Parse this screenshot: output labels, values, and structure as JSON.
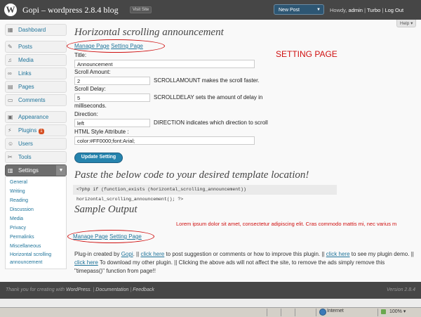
{
  "header": {
    "logo_letter": "W",
    "site_title": "Gopi – wordpress 2.8.4 blog",
    "visit_site": "Visit Site",
    "new_post": "New Post",
    "howdy": "Howdy,",
    "username": "admin",
    "turbo": "Turbo",
    "logout": "Log Out"
  },
  "help": "Help",
  "sidebar": {
    "dashboard": "Dashboard",
    "posts": "Posts",
    "media": "Media",
    "links": "Links",
    "pages": "Pages",
    "comments": "Comments",
    "appearance": "Appearance",
    "plugins": "Plugins",
    "plugins_badge": "1",
    "users": "Users",
    "tools": "Tools",
    "settings": "Settings",
    "settings_sub": [
      "General",
      "Writing",
      "Reading",
      "Discussion",
      "Media",
      "Privacy",
      "Permalinks",
      "Miscellaneous",
      "Horizontal scrolling announcement"
    ]
  },
  "main": {
    "title": "Horizontal scrolling announcement",
    "manage_page": "Manage Page",
    "setting_page_link": "Setting Page",
    "setting_page_label": "SETTING PAGE",
    "form": {
      "title_label": "Title:",
      "title_value": "Announcement",
      "scroll_amount_label": "Scroll Amount:",
      "scroll_amount_value": "2",
      "scroll_amount_desc": "SCROLLAMOUNT makes the scroll faster.",
      "scroll_delay_label": "Scroll Delay:",
      "scroll_delay_value": "5",
      "scroll_delay_desc_1": "SCROLLDELAY sets the amount of delay in",
      "scroll_delay_desc_2": "milliseconds.",
      "direction_label": "Direction:",
      "direction_value": "left",
      "direction_desc": "DIRECTION indicates which direction to scroll",
      "style_label": "HTML Style Attribute :",
      "style_value": "color:#FF0000;font:Arial;",
      "save_button": "Update Setting"
    },
    "code_title": "Paste the below code to your desired template location!",
    "code": "<?php if (function_exists (horizontal_scrolling_announcement)) horizontal_scrolling_announcement(); ?>",
    "sample_title": "Sample Output",
    "marquee_text": "Lorem ipsum dolor sit amet, consectetur adipiscing elit. Cras commodo mattis mi, nec varius m",
    "credits": {
      "p1": "Plug-in created by ",
      "author": "Gopi",
      "p2": ". || ",
      "click1": "click here",
      "p3": " to post suggestion or comments or how to improve this plugin. || ",
      "click2": "click here",
      "p4": " to see my plugin demo. || ",
      "click3": "click here",
      "p5": " To download my other plugin. || Clicking the above ads will not affect the site, to remove the ads simply remove this \"timepass()\" function from page!!"
    }
  },
  "footer": {
    "thanks": "Thank you for creating with ",
    "wordpress": "WordPress",
    "documentation": "Documentation",
    "feedback": "Feedback",
    "version": "Version 2.8.4"
  },
  "statusbar": {
    "zone": "Internet",
    "zoom": "100%"
  }
}
